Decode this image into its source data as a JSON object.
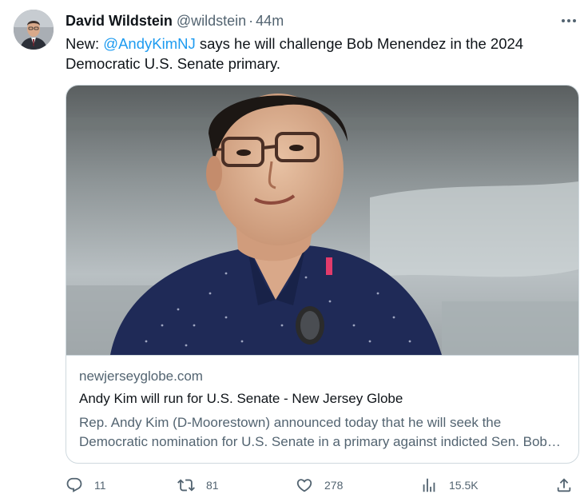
{
  "author": {
    "name": "David Wildstein",
    "handle": "@wildstein",
    "separator": "·",
    "time": "44m"
  },
  "tweet": {
    "prefix": "New: ",
    "mention": "@AndyKimNJ",
    "rest": " says he will challenge Bob Menendez in the 2024 Democratic U.S. Senate primary."
  },
  "card": {
    "domain": "newjerseyglobe.com",
    "title": "Andy Kim will run for U.S. Senate - New Jersey Globe",
    "description": "Rep. Andy Kim (D-Moorestown) announced today that he will seek the Democratic nomination for U.S. Senate in a primary against indicted Sen. Bob Menendez."
  },
  "actions": {
    "replies": "11",
    "reposts": "81",
    "likes": "278",
    "views": "15.5K"
  },
  "icons": {
    "more": "more-dots-icon",
    "reply": "reply-icon",
    "repost": "repost-icon",
    "like": "heart-icon",
    "views": "views-icon",
    "share": "share-icon"
  },
  "colors": {
    "text": "#0f1419",
    "muted": "#536471",
    "link": "#1d9bf0",
    "border": "#cfd9de"
  }
}
